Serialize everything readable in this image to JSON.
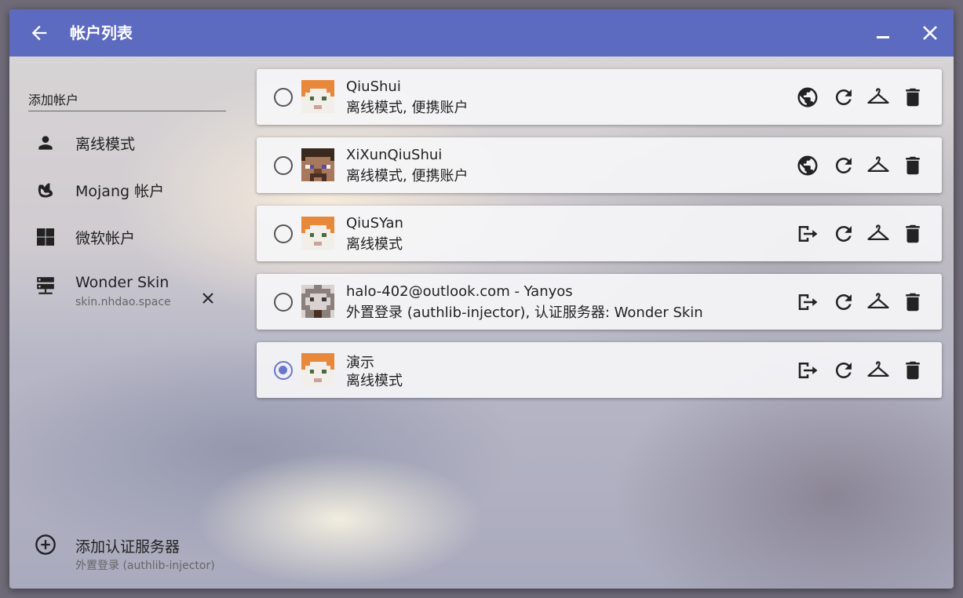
{
  "window": {
    "title": "帐户列表",
    "back_icon": "arrow-left-icon",
    "minimize_icon": "minimize-icon",
    "close_icon": "close-icon",
    "titlebar_color": "#5c6bc0"
  },
  "sidebar": {
    "add_account_label": "添加帐户",
    "items": [
      {
        "label": "离线模式",
        "icon": "person-icon"
      },
      {
        "label": "Mojang 帐户",
        "icon": "mojang-icon"
      },
      {
        "label": "微软帐户",
        "icon": "microsoft-icon"
      },
      {
        "label": "Wonder Skin",
        "sub": "skin.nhdao.space",
        "icon": "server-icon"
      }
    ],
    "add_server": {
      "label": "添加认证服务器",
      "sub": "外置登录 (authlib-injector)",
      "icon": "add-circle-icon"
    }
  },
  "accounts": [
    {
      "name": "QiuShui",
      "sub": "离线模式, 便携账户",
      "selected": false,
      "avatar": "alex",
      "first_action": "globe-icon"
    },
    {
      "name": "XiXunQiuShui",
      "sub": "离线模式, 便携账户",
      "selected": false,
      "avatar": "steve",
      "first_action": "globe-icon"
    },
    {
      "name": "QiuSYan",
      "sub": "离线模式",
      "selected": false,
      "avatar": "alex",
      "first_action": "logout-icon"
    },
    {
      "name": "halo-402@outlook.com - Yanyos",
      "sub": "外置登录 (authlib-injector), 认证服务器: Wonder Skin",
      "selected": false,
      "avatar": "custom",
      "first_action": "logout-icon"
    },
    {
      "name": "演示",
      "sub": "离线模式",
      "selected": true,
      "avatar": "alex",
      "first_action": "logout-icon"
    }
  ],
  "action_icons": [
    "refresh-icon",
    "hanger-icon",
    "delete-icon"
  ],
  "colors": {
    "accent": "#5c6bc0",
    "radio_selected": "#6a76c9"
  }
}
